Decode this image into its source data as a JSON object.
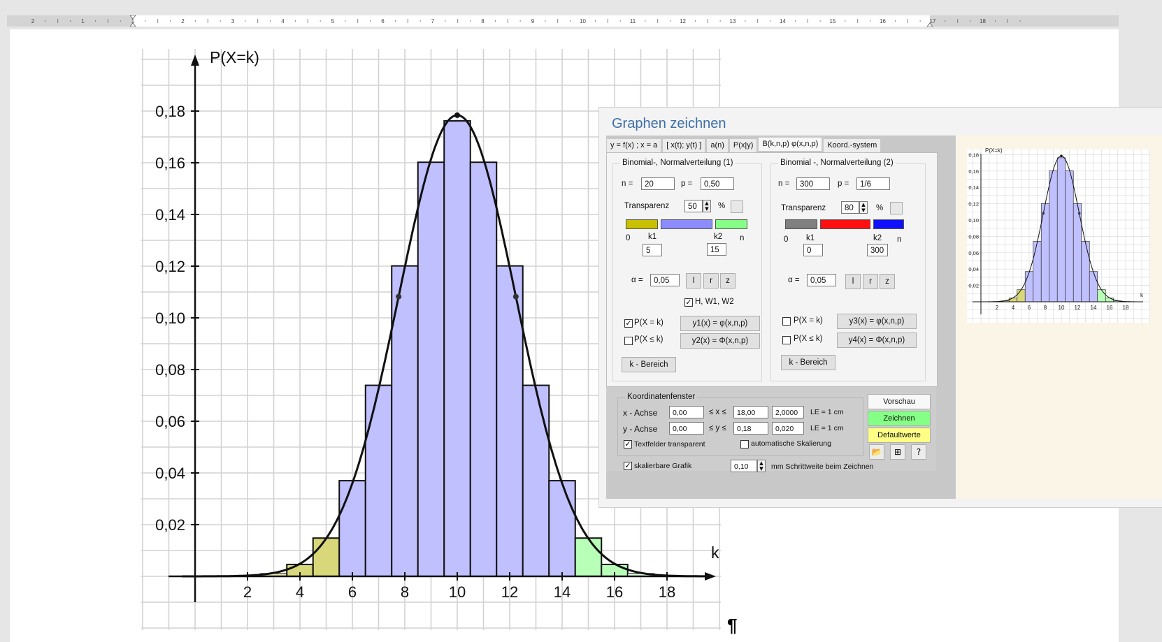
{
  "ruler": {
    "numbers": [
      "2",
      "1",
      "1",
      "2",
      "3",
      "4",
      "5",
      "6",
      "7",
      "8",
      "9",
      "10",
      "11",
      "12",
      "13",
      "14",
      "15",
      "16",
      "17",
      "18"
    ]
  },
  "chart_data": {
    "type": "bar",
    "title": "",
    "ylabel": "P(X=k)",
    "xlabel": "k",
    "x": [
      2,
      3,
      4,
      5,
      6,
      7,
      8,
      9,
      10,
      11,
      12,
      13,
      14,
      15,
      16,
      17,
      18
    ],
    "values": [
      0.0002,
      0.0011,
      0.0046,
      0.0148,
      0.037,
      0.0739,
      0.1201,
      0.1602,
      0.1762,
      0.1602,
      0.1201,
      0.0739,
      0.037,
      0.0148,
      0.0046,
      0.0011,
      0.0002
    ],
    "bar_colors": [
      "#f4f4dc",
      "#e8e8b0",
      "#d8d87a",
      "#d8d87a",
      "#c0c0ff",
      "#c0c0ff",
      "#c0c0ff",
      "#c0c0ff",
      "#c0c0ff",
      "#c0c0ff",
      "#c0c0ff",
      "#c0c0ff",
      "#c0c0ff",
      "#b8ffb8",
      "#b8ffb8",
      "#e0ffe0",
      "#f4fff4"
    ],
    "curve": "normal density with mean 10 and sd 2.236",
    "xticks": [
      "2",
      "4",
      "6",
      "8",
      "10",
      "12",
      "14",
      "16",
      "18"
    ],
    "yticks": [
      "0,02",
      "0,04",
      "0,06",
      "0,08",
      "0,10",
      "0,12",
      "0,14",
      "0,16",
      "0,18"
    ],
    "xlim": [
      0,
      19
    ],
    "ylim": [
      0,
      0.19
    ],
    "grid": true
  },
  "preview_chart": {
    "ylabel": "P(X=k)",
    "xlabel": "k",
    "xticks": [
      "2",
      "4",
      "6",
      "8",
      "10",
      "12",
      "14",
      "16",
      "18"
    ],
    "yticks": [
      "0,02",
      "0,04",
      "0,06",
      "0,08",
      "0,10",
      "0,12",
      "0,14",
      "0,16",
      "0,18"
    ]
  },
  "pilcrow": "¶",
  "dialog": {
    "title": "Graphen zeichnen",
    "tabs": [
      "y = f(x) ;  x = a",
      "[ x(t); y(t) ]",
      "a(n)",
      "P(x|y)",
      "B(k,n,p)  φ(x,n,p)",
      "Koord.-system"
    ],
    "active_tab": 4,
    "g1": {
      "title": "Binomial-, Normalverteilung (1)",
      "n_label": "n =",
      "n": "20",
      "p_label": "p =",
      "p": "0,50",
      "transp_label": "Transparenz",
      "transp": "50",
      "pct": "%",
      "colors": [
        "#c8c000",
        "#8c8cff",
        "#86ff86"
      ],
      "zero": "0",
      "k1_label": "k1",
      "k2_label": "k2",
      "n_small": "n",
      "k1": "5",
      "k2": "15",
      "alpha_label": "α =",
      "alpha": "0,05",
      "btn_l": "l",
      "btn_r": "r",
      "btn_z": "z",
      "hw": "H, W1, W2",
      "hw_checked": true,
      "pk": "P(X = k)",
      "pk_checked": true,
      "y1": "y1(x) = φ(x,n,p)",
      "pleq": "P(X ≤ k)",
      "pleq_checked": false,
      "y2": "y2(x) = Φ(x,n,p)",
      "range": "k - Bereich"
    },
    "g2": {
      "title": "Binomial -, Normalverteilung (2)",
      "n_label": "n =",
      "n": "300",
      "p_label": "p =",
      "p": "1/6",
      "transp_label": "Transparenz",
      "transp": "80",
      "pct": "%",
      "colors": [
        "#808080",
        "#ff1010",
        "#1010ff"
      ],
      "zero": "0",
      "k1_label": "k1",
      "k2_label": "k2",
      "n_small": "n",
      "k1": "0",
      "k2": "300",
      "alpha_label": "α =",
      "alpha": "0,05",
      "btn_l": "l",
      "btn_r": "r",
      "btn_z": "z",
      "pk": "P(X = k)",
      "pk_checked": false,
      "y3": "y3(x) = φ(x,n,p)",
      "pleq": "P(X ≤ k)",
      "pleq_checked": false,
      "y4": "y4(x) = Φ(x,n,p)",
      "range": "k - Bereich"
    },
    "koord": {
      "title": "Koordinatenfenster",
      "x_label": "x - Achse",
      "xmin": "0,00",
      "leq": "≤ x ≤",
      "xmax": "18,00",
      "xstep": "2,0000",
      "le": "LE = 1 cm",
      "y_label": "y - Achse",
      "ymin": "0,00",
      "leqy": "≤ y ≤",
      "ymax": "0,18",
      "ystep": "0,020",
      "ley": "LE = 1 cm",
      "transparent": "Textfelder transparent",
      "auto": "automatische Skalierung",
      "scalable": "skalierbare Grafik",
      "step": "0,10",
      "step_label": "mm Schrittweite beim Zeichnen"
    },
    "buttons": {
      "preview": "Vorschau",
      "draw": "Zeichnen",
      "defaults": "Defaultwerte"
    },
    "button_colors": {
      "preview": "#f8f8f8",
      "draw": "#86ff86",
      "defaults": "#ffff86"
    }
  }
}
